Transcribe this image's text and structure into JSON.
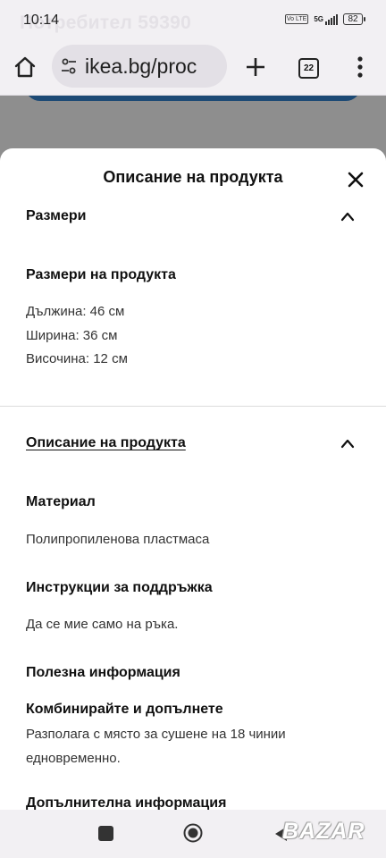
{
  "status_bar": {
    "time": "10:14",
    "ghost_text": "Потребител 59390",
    "volte": "Vo LTE",
    "network": "5G",
    "battery": "82"
  },
  "browser": {
    "url": "ikea.bg/proc",
    "tab_count": "22"
  },
  "sheet": {
    "title": "Описание на продукта",
    "sections": {
      "dimensions": {
        "header": "Размери",
        "subheading": "Размери на продукта",
        "lines": [
          "Дължина: 46 см",
          "Ширина: 36 см",
          "Височина: 12 см"
        ]
      },
      "description": {
        "header": "Описание на продукта",
        "material_title": "Материал",
        "material_text": "Полипропиленова пластмаса",
        "care_title": "Инструкции за поддръжка",
        "care_text": "Да се мие само на ръка.",
        "useful_title": "Полезна информация",
        "combine_title": "Комбинирайте и допълнете",
        "combine_text": [
          "Разполага с място за сушене на 18 чинии",
          "едновременно."
        ],
        "additional_title": "Допълнителна информация"
      }
    }
  },
  "watermark": "BAZAR",
  "icons": {
    "home": "home-icon",
    "tune": "site-settings-icon",
    "plus": "new-tab-icon",
    "menu": "more-vert-icon",
    "close": "close-icon",
    "chevron": "chevron-up-icon"
  }
}
